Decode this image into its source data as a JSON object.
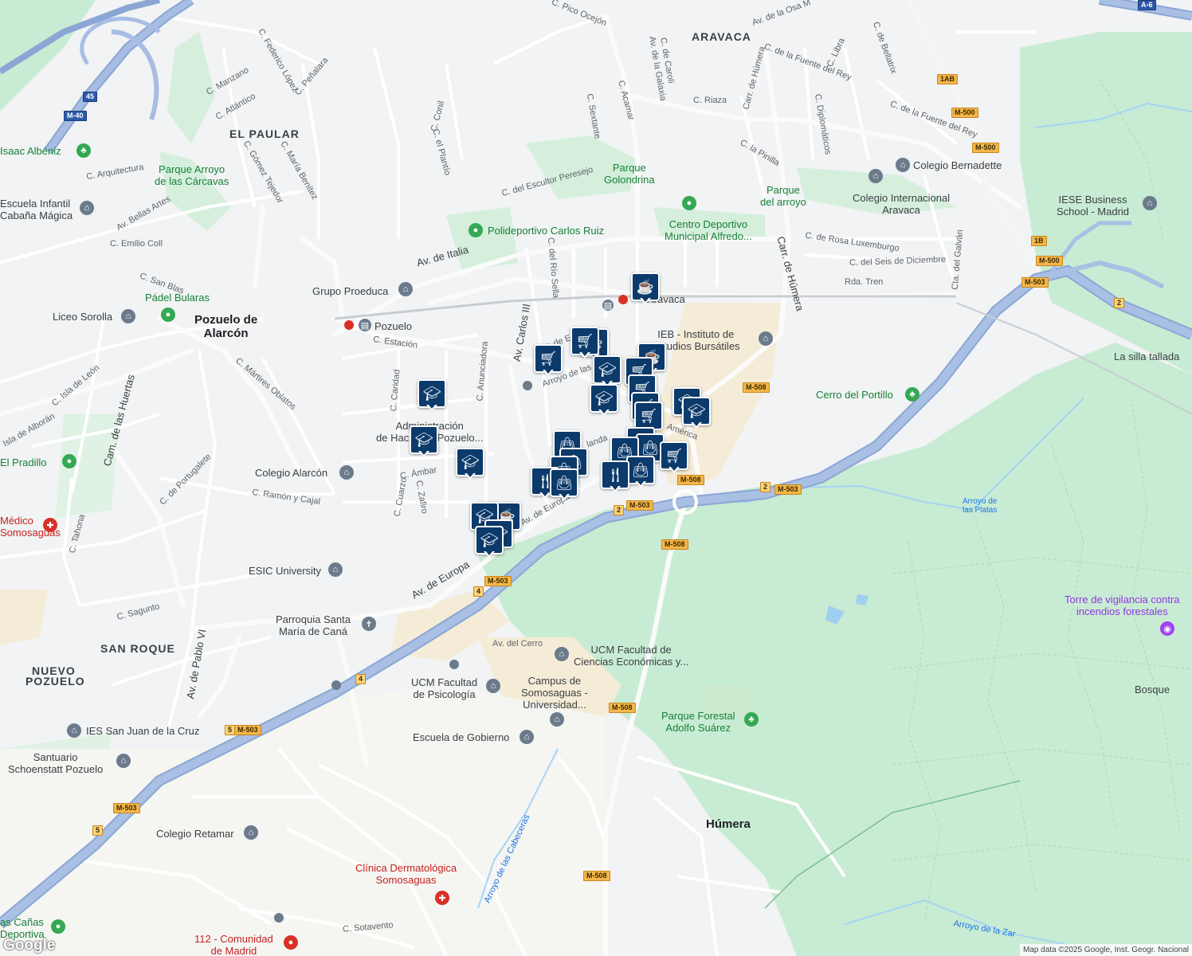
{
  "map": {
    "attribution": "Map data ©2025 Google, Inst. Geogr. Nacional",
    "logo": "Google",
    "areas": [
      {
        "text": "ARAVACA"
      },
      {
        "text": "EL PAULAR"
      },
      {
        "text": "SAN ROQUE"
      },
      {
        "text": "NUEVO"
      },
      {
        "text": "POZUELO"
      }
    ],
    "towns": [
      {
        "line1": "Pozuelo de",
        "line2": "Alarcón"
      },
      {
        "line1": "Húmera",
        "line2": ""
      }
    ],
    "streets": [
      "C. Pico Ocejón",
      "Av. de la Osa M",
      "C. de Caroli",
      "Av. de la Galaxia",
      "C. Acamar",
      "C. Sextante",
      "C. Federico López",
      "C. Peñalara",
      "C. Manzano",
      "C. Atlántico",
      "C. Conil",
      "C. el Plantío",
      "C. Gómez Tejedor",
      "C. María Benítez",
      "C. Arquitectura",
      "Av. Bellas Artes",
      "C. Emilio Coll",
      "C. San Blas",
      "C. del Escultor Peresejo",
      "Av. de Italia",
      "C. del Río Sella",
      "Av. Carlos III",
      "C. Estación",
      "C. Mártires Oblatos",
      "C. Isla de León",
      "Isla de Alborán",
      "Cam. de las Huertas",
      "C. Caridad",
      "C. Anunciadora",
      "C. Ámbar",
      "C. Zafiro",
      "C. Cuarzo",
      "C. de Portugalete",
      "C. Ramón y Cajal",
      "C. Tahona",
      "C. Sagunto",
      "Av. de Pablo VI",
      "Av. de Europa",
      "Av. de Europa",
      "Av. del Cerro",
      "C. Riaza",
      "Carr. de Húmera",
      "C. de la Fuente del Rey",
      "C. Diplomáticos",
      "C. la Pinilla",
      "C. Libra",
      "C. de Bellatrix",
      "C. de la Fuente del Rey",
      "C. de Rosa Luxemburgo",
      "C. del Seis de Diciembre",
      "Cta. del Galván",
      "Rda. Tren",
      "Carr. de Húmera",
      "Arroyo de las Cabeceras",
      "Arroyo de la Zar",
      "C. Sotavento",
      "Arroyo de las Platas",
      "Av. de Europa",
      "Talgo",
      "landa",
      "América"
    ],
    "pois": [
      {
        "text": "Parque Arroyo\nde las Cárcavas",
        "kind": "green"
      },
      {
        "text": "Isaac Albéniz",
        "kind": "green"
      },
      {
        "text": "Escuela Infantil\nCabaña Mágica",
        "kind": "grey"
      },
      {
        "text": "Polideportivo Carlos Ruiz",
        "kind": "green"
      },
      {
        "text": "Parque\nGolondrina",
        "kind": "green"
      },
      {
        "text": "Centro Deportivo\nMunicipal Alfredo...",
        "kind": "green"
      },
      {
        "text": "Parque\ndel arroyo",
        "kind": "green"
      },
      {
        "text": "Colegio Bernadette",
        "kind": "grey"
      },
      {
        "text": "Colegio Internacional\nAravaca",
        "kind": "grey"
      },
      {
        "text": "IESE Business\nSchool - Madrid",
        "kind": "grey"
      },
      {
        "text": "Grupo Proeduca",
        "kind": "grey"
      },
      {
        "text": "Pádel Bularas",
        "kind": "green"
      },
      {
        "text": "Liceo Sorolla",
        "kind": "grey"
      },
      {
        "text": "Pozuelo",
        "kind": "transit"
      },
      {
        "text": "Aravaca",
        "kind": "transit"
      },
      {
        "text": "IEB - Instituto de\nEstudios Bursátiles",
        "kind": "grey"
      },
      {
        "text": "La silla tallada",
        "kind": "grey"
      },
      {
        "text": "Cerro del Portillo",
        "kind": "green"
      },
      {
        "text": "Administración\nde Hacienda Pozuelo...",
        "kind": "grey"
      },
      {
        "text": "Colegio Alarcón",
        "kind": "grey"
      },
      {
        "text": "El Pradillo",
        "kind": "green"
      },
      {
        "text": "Médico\nSomosaguas",
        "kind": "red"
      },
      {
        "text": "ESIC University",
        "kind": "grey"
      },
      {
        "text": "Parroquia Santa\nMaría de Caná",
        "kind": "grey"
      },
      {
        "text": "UCM Facultad de\nCiencias Económicas y...",
        "kind": "grey"
      },
      {
        "text": "UCM Facultad\nde Psicología",
        "kind": "grey"
      },
      {
        "text": "Campus de\nSomosaguas -\nUniversidad...",
        "kind": "grey"
      },
      {
        "text": "Torre de vigilancia contra\nincendios forestales",
        "kind": "purple"
      },
      {
        "text": "Bosque",
        "kind": "grey"
      },
      {
        "text": "Parque Forestal\nAdolfo Suárez",
        "kind": "green"
      },
      {
        "text": "IES San Juan de la Cruz",
        "kind": "grey"
      },
      {
        "text": "Santuario\nSchoenstatt Pozuelo",
        "kind": "grey"
      },
      {
        "text": "Escuela de Gobierno",
        "kind": "grey"
      },
      {
        "text": "Colegio Retamar",
        "kind": "grey"
      },
      {
        "text": "Clínica Dermatológica\nSomosaguas",
        "kind": "red"
      },
      {
        "text": "112 - Comunidad\nde Madrid",
        "kind": "red"
      },
      {
        "text": "as Cañas\nDeportiva",
        "kind": "green"
      },
      {
        "text": "Arroyo de\nlas Platas",
        "kind": "water"
      }
    ],
    "shields": [
      "A-6",
      "M-40",
      "45",
      "1AB",
      "M-500",
      "M-500",
      "1B",
      "M-500",
      "M-503",
      "2",
      "M-508",
      "M-508",
      "2",
      "M-503",
      "M-503",
      "2",
      "M-508",
      "M-503",
      "4",
      "4",
      "M-508",
      "5",
      "M-503",
      "M-503",
      "5",
      "M-508"
    ],
    "markers": {
      "education": "education-icon",
      "shopping_cart": "shopping-cart-icon",
      "cafe": "coffee-icon",
      "restaurant": "restaurant-icon",
      "shopping_bag": "shopping-bag-icon"
    }
  }
}
